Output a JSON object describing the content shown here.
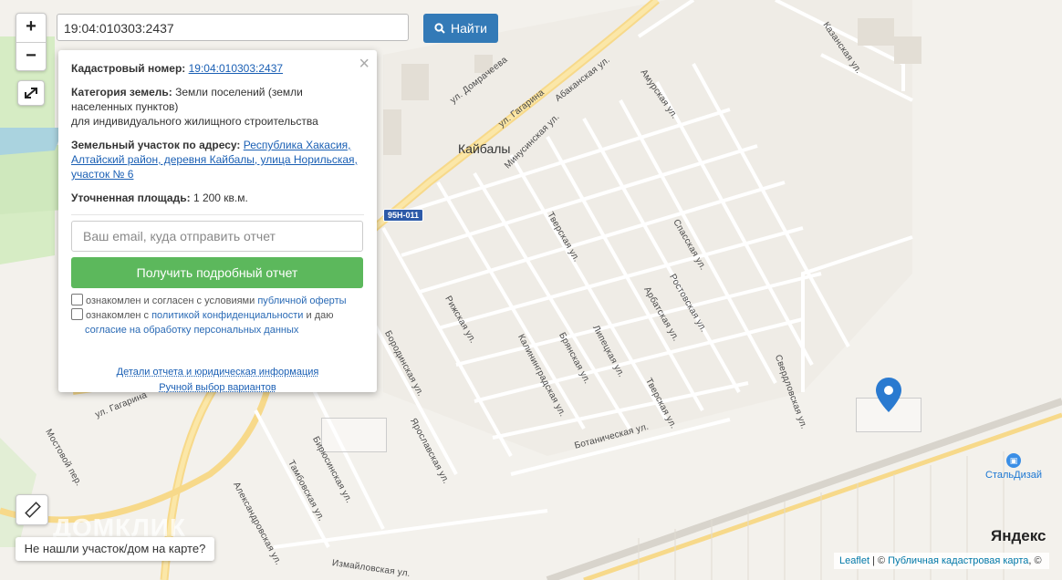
{
  "search": {
    "value": "19:04:010303:2437",
    "button_label": "Найти"
  },
  "zoom": {
    "in_label": "+",
    "out_label": "−"
  },
  "popup": {
    "cadastral_label": "Кадастровый номер:",
    "cadastral_value": "19:04:010303:2437",
    "category_label": "Категория земель:",
    "category_value": "Земли поселений (земли населенных пунктов)",
    "category_use": "для индивидуального жилищного строительства",
    "address_label": "Земельный участок по адресу:",
    "address_value": "Республика Хакасия, Алтайский район, деревня Кайбалы, улица Норильская, участок № 6",
    "area_label": "Уточненная площадь:",
    "area_value": "1 200 кв.м.",
    "email_placeholder": "Ваш email, куда отправить отчет",
    "report_button": "Получить подробный отчет",
    "checkbox1_text": "ознакомлен и согласен с условиями",
    "checkbox1_link": "публичной оферты",
    "checkbox2_text": "ознакомлен с",
    "checkbox2_link": "политикой конфиденциальности",
    "checkbox2_and": "и даю",
    "checkbox2_link2": "согласие на обработку персональных данных",
    "details_link": "Детали отчета и юридическая информация",
    "manual_link": "Ручной выбор вариантов",
    "close": "×"
  },
  "map": {
    "town": "Кайбалы",
    "road_shield": "95Н-011",
    "streets": [
      {
        "name": "ул. Домрачеева"
      },
      {
        "name": "ул. Гагарина"
      },
      {
        "name": "Абаканская ул."
      },
      {
        "name": "Амурская ул."
      },
      {
        "name": "Казанская ул."
      },
      {
        "name": "Минусинская ул."
      },
      {
        "name": "Тверская ул."
      },
      {
        "name": "Спасская ул."
      },
      {
        "name": "Ростовская ул."
      },
      {
        "name": "Арбатская ул."
      },
      {
        "name": "Рижская ул."
      },
      {
        "name": "Бородинская ул."
      },
      {
        "name": "Калининградская ул."
      },
      {
        "name": "Брянская ул."
      },
      {
        "name": "Липецкая ул."
      },
      {
        "name": "Тверская ул."
      },
      {
        "name": "Свердловская ул."
      },
      {
        "name": "Ботаническая ул."
      },
      {
        "name": "Ярославская ул."
      },
      {
        "name": "Бирюсинская ул."
      },
      {
        "name": "Тамбовская ул."
      },
      {
        "name": "Александровская ул."
      },
      {
        "name": "Измайловская ул."
      },
      {
        "name": "Мостовой пер."
      },
      {
        "name": "ул. Гагарина"
      }
    ],
    "poi_label": "СтальДизай",
    "watermark": "ДОМКЛИК"
  },
  "notfound_button": "Не нашли участок/дом на карте?",
  "yandex": "Яндекс",
  "attribution": {
    "leaflet": "Leaflet",
    "sep": " | © ",
    "pkk": "Публичная кадастровая карта",
    "tail": ", ©"
  },
  "colors": {
    "accent": "#337ab7",
    "report": "#5cb85c",
    "pin": "#2a7ad0"
  }
}
